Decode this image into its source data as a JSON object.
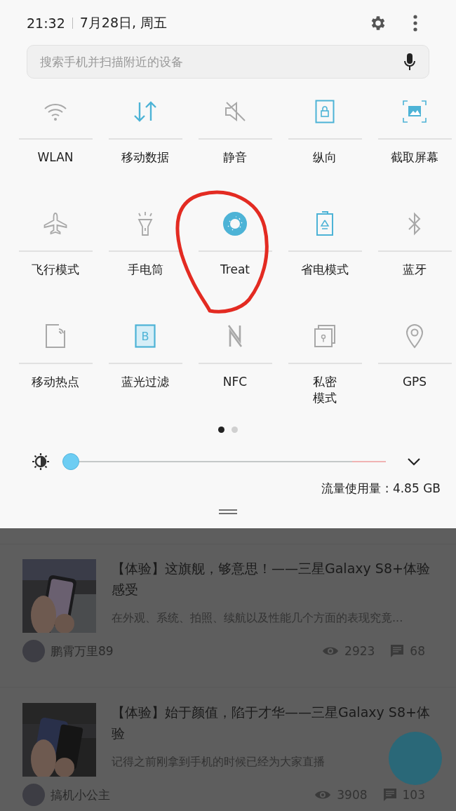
{
  "status": {
    "time": "21:32",
    "date": "7月28日, 周五"
  },
  "search": {
    "placeholder": "搜索手机并扫描附近的设备"
  },
  "tiles": [
    {
      "label": "WLAN",
      "kind": "wifi",
      "on": false
    },
    {
      "label": "移动数据",
      "kind": "data",
      "on": true
    },
    {
      "label": "静音",
      "kind": "mute",
      "on": false
    },
    {
      "label": "纵向",
      "kind": "portrait",
      "on": true
    },
    {
      "label": "截取屏幕",
      "kind": "screenshot",
      "on": true
    },
    {
      "label": "飞行模式",
      "kind": "airplane",
      "on": false
    },
    {
      "label": "手电筒",
      "kind": "flashlight",
      "on": false
    },
    {
      "label": "Treat",
      "kind": "donut",
      "on": true
    },
    {
      "label": "省电模式",
      "kind": "battery",
      "on": true
    },
    {
      "label": "蓝牙",
      "kind": "bluetooth",
      "on": false
    },
    {
      "label": "移动热点",
      "kind": "hotspot",
      "on": false
    },
    {
      "label": "蓝光过滤",
      "kind": "bluelight",
      "on": true,
      "glyph": "B"
    },
    {
      "label": "NFC",
      "kind": "nfc",
      "on": false
    },
    {
      "label": "私密模式",
      "kind": "private",
      "on": false
    },
    {
      "label": "GPS",
      "kind": "location",
      "on": false
    }
  ],
  "pages": [
    {
      "selected": true
    },
    {
      "selected": false
    }
  ],
  "brightness": {
    "level": 0
  },
  "data_usage": "流量使用量 : 4.85 GB",
  "posts": [
    {
      "title": "【体验】这旗舰，够意思！——三星Galaxy S8+体验感受",
      "excerpt": "在外观、系统、拍照、续航以及性能几个方面的表现究竟...",
      "author": "鹏霄万里89",
      "views": "2923",
      "comments": "68"
    },
    {
      "title": "【体验】始于颜值，陷于才华——三星Galaxy S8+体验",
      "excerpt": "记得之前刚拿到手机的时候已经为大家直播",
      "author": "搞机小公主",
      "views": "3908",
      "comments": "103"
    }
  ]
}
